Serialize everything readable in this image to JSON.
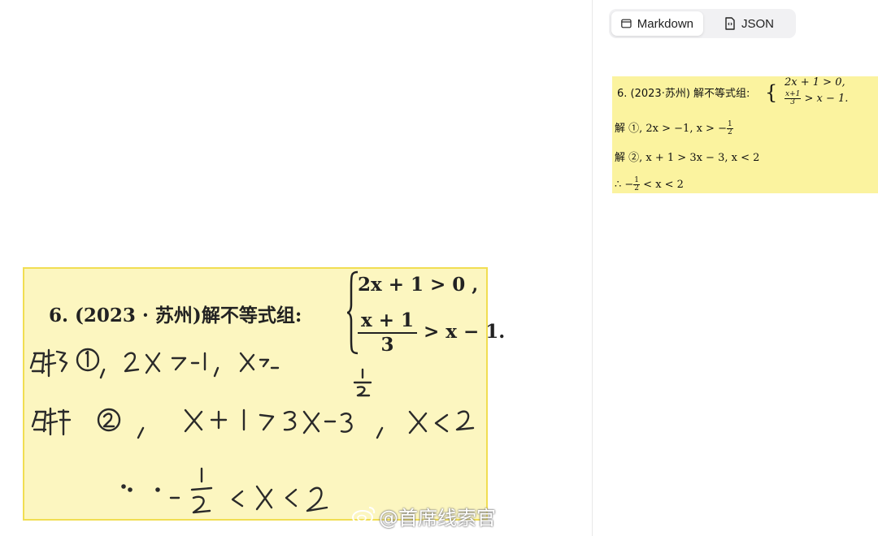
{
  "tabs": {
    "markdown_label": "Markdown",
    "json_label": "JSON",
    "active": "markdown"
  },
  "scan": {
    "question_prefix": "6. (2023 · 苏州)解不等式组:",
    "eq1": "2x + 1 > 0 ,",
    "eq2_num": "x + 1",
    "eq2_den": "3",
    "eq2_rest": "> x − 1.",
    "hand_line1": "解 ①, 2x > −1, x > −½",
    "hand_line2": "解 ②, x + 1 > 3x − 3, x < 2",
    "hand_line3": "∴ −½ < x < 2"
  },
  "watermark": {
    "text": "@首席线索官"
  },
  "markdown_render": {
    "question": "6. (2023·苏州) 解不等式组:",
    "eq1": "2x + 1 > 0,",
    "eq2_num": "x+1",
    "eq2_den": "3",
    "eq2_rest": "> x − 1.",
    "line1_prefix": "解 ①, 2x > −1, x > −",
    "line2": "解 ②, x + 1 > 3x − 3, x < 2",
    "line3_prefix": "∴ −",
    "line3_suffix": "< x < 2",
    "half_num": "1",
    "half_den": "2"
  },
  "colors": {
    "scan_bg": "#fcf6c0",
    "scan_border": "#f1de52",
    "md_bg": "#fbf39f",
    "tab_bg": "#f1f1f3"
  }
}
